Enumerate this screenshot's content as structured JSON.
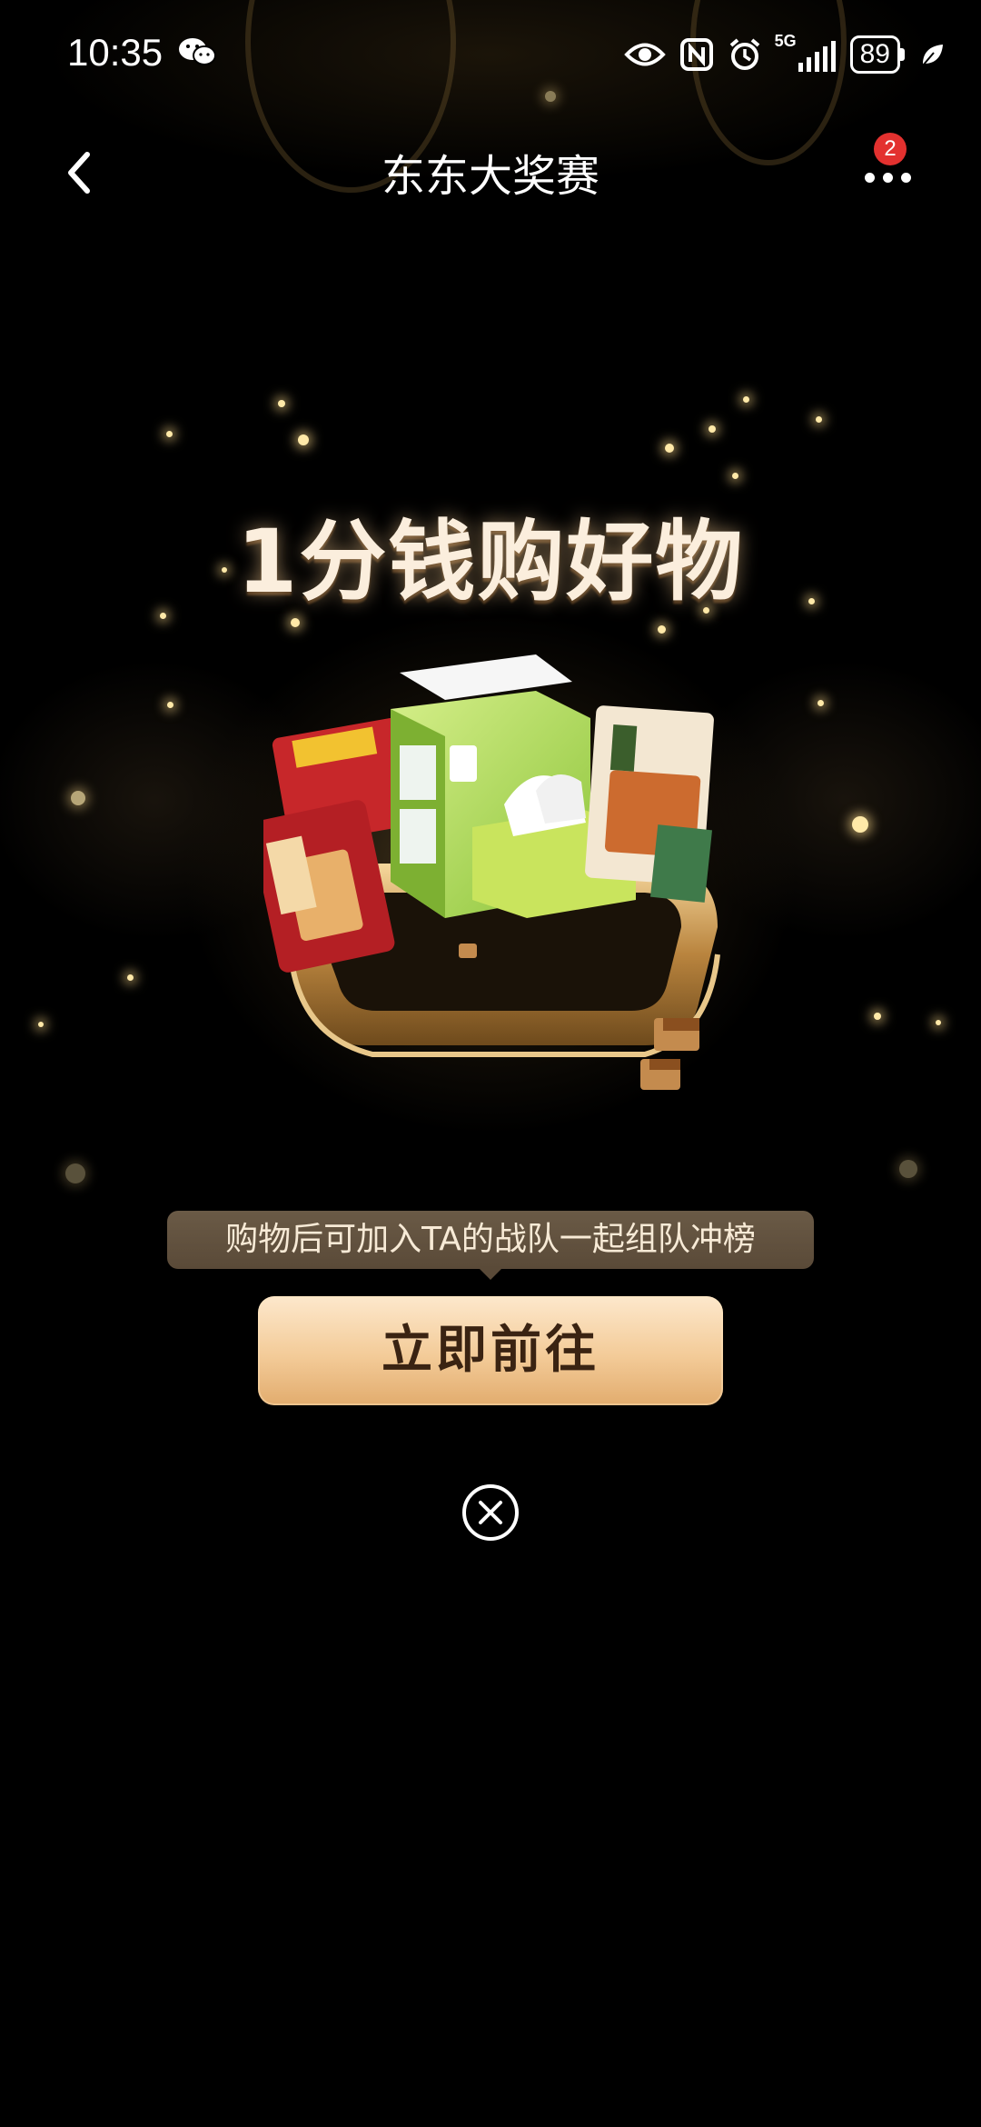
{
  "status_bar": {
    "time": "10:35",
    "network": "5G",
    "battery": "89",
    "icons": [
      "wechat-icon",
      "eye-icon",
      "nfc-icon",
      "alarm-icon",
      "signal-icon",
      "battery-icon",
      "leaf-icon"
    ]
  },
  "nav": {
    "title": "东东大奖赛",
    "back_icon": "chevron-left-icon",
    "more_icon": "more-dots-icon",
    "badge_count": "2"
  },
  "promo": {
    "headline": "1分钱购好物",
    "hint": "购物后可加入TA的战队一起组队冲榜",
    "cta_label": "立即前往",
    "close_icon": "close-circle-icon"
  },
  "colors": {
    "background": "#000000",
    "cta_gradient_top": "#fde8cc",
    "cta_gradient_bottom": "#e2ac6e",
    "cta_text": "#3a2312",
    "badge": "#e3312f",
    "hint_bg": "#5a4a38"
  }
}
